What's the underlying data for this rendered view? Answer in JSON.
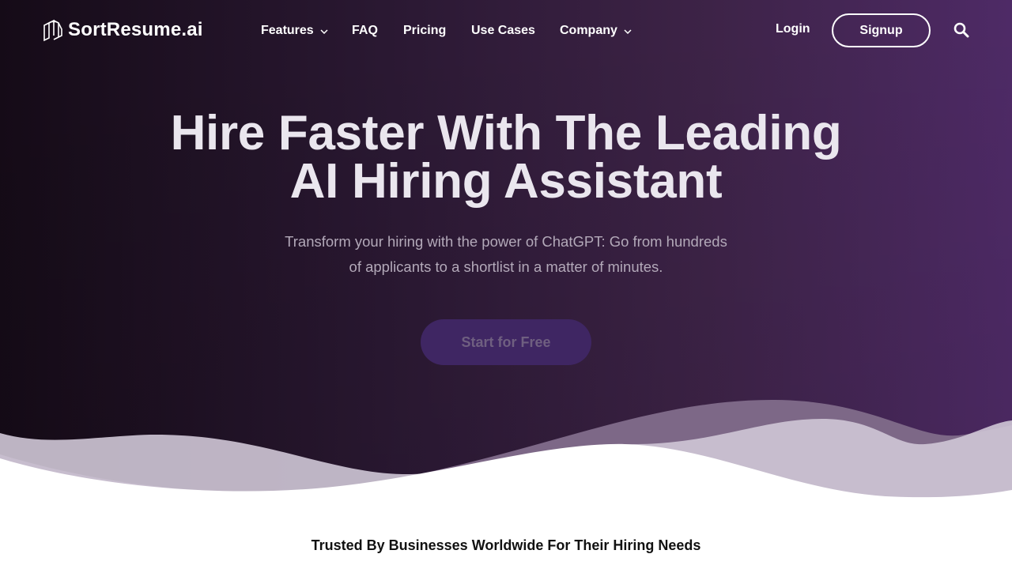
{
  "brand": {
    "name": "SortResume.ai",
    "icon": "stacked-pages-logo-icon"
  },
  "nav": {
    "items": [
      {
        "label": "Features",
        "has_dropdown": true
      },
      {
        "label": "FAQ",
        "has_dropdown": false
      },
      {
        "label": "Pricing",
        "has_dropdown": false
      },
      {
        "label": "Use Cases",
        "has_dropdown": false
      },
      {
        "label": "Company",
        "has_dropdown": true
      }
    ],
    "login_label": "Login",
    "signup_label": "Signup",
    "search_icon": "search-icon"
  },
  "hero": {
    "headline_line1": "Hire Faster With The Leading",
    "headline_line2": "AI Hiring Assistant",
    "subtext_line1": "Transform your hiring with the power of ChatGPT: Go from hundreds",
    "subtext_line2": "of applicants to a shortlist in a matter of minutes.",
    "cta_label": "Start for Free"
  },
  "trusted": {
    "heading": "Trusted By Businesses Worldwide For Their Hiring Needs"
  },
  "colors": {
    "gradient_start": "#150b17",
    "gradient_end": "#4e2a66",
    "cta_background": "#3f2663",
    "heading_text": "#eae6ee"
  }
}
